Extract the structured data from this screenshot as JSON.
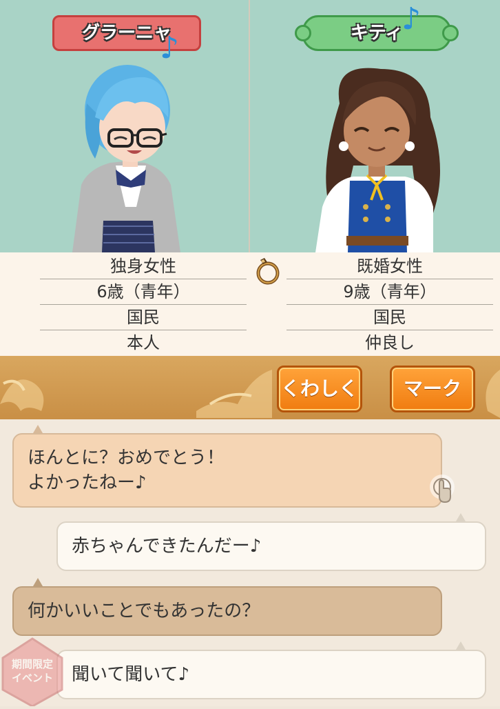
{
  "characters": {
    "left": {
      "name": "グラーニャ",
      "info": [
        "独身女性",
        "6歳（青年）",
        "国民",
        "本人"
      ],
      "plate_color": "#e8716f"
    },
    "right": {
      "name": "キティ",
      "info": [
        "既婚女性",
        "9歳（青年）",
        "国民",
        "仲良し"
      ],
      "plate_color": "#7bcd84",
      "status_icon": "ring-icon"
    }
  },
  "actions": {
    "details_label": "くわしく",
    "mark_label": "マーク"
  },
  "chat": {
    "messages": [
      {
        "side": "left",
        "lines": [
          "ほんとに？おめでとう！",
          "よかったねー♪"
        ]
      },
      {
        "side": "right",
        "text": "赤ちゃんできたんだー♪"
      },
      {
        "side": "left",
        "text": "何かいいことでもあったの？"
      },
      {
        "side": "right",
        "text": "聞いて聞いて♪"
      }
    ]
  },
  "event_badge": {
    "lines": [
      "期間限定",
      "イベント"
    ]
  },
  "icons": {
    "music_note": "music-note-icon",
    "tap": "tap-icon"
  }
}
